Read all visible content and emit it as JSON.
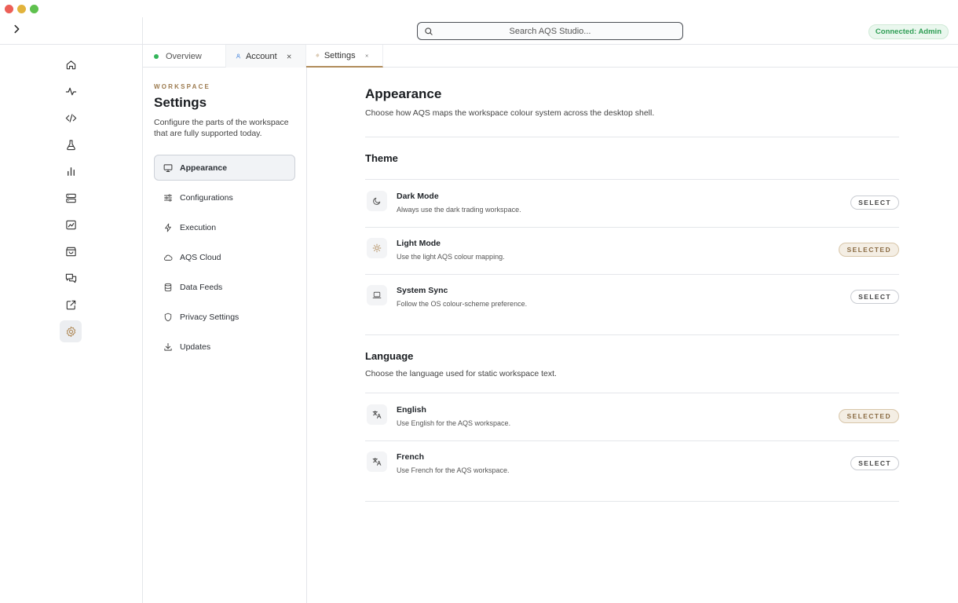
{
  "app": {
    "search_placeholder": "Search AQS Studio...",
    "connection_badge": "Connected: Admin"
  },
  "rail": {
    "icons": [
      "home-icon",
      "activity-icon",
      "code-icon",
      "flask-icon",
      "bar-chart-icon",
      "server-icon",
      "line-chart-icon",
      "shopping-bag-icon",
      "chat-icon",
      "external-link-icon",
      "gear-icon"
    ],
    "active": "gear-icon"
  },
  "tabs": [
    {
      "label": "Overview",
      "status_color": "#33b55a"
    },
    {
      "label": "Account"
    },
    {
      "label": "Settings",
      "active": true
    }
  ],
  "subnav": {
    "kicker": "WORKSPACE",
    "title": "Settings",
    "description": "Configure the parts of the workspace that are fully supported today.",
    "items": [
      {
        "label": "Appearance",
        "icon": "monitor-icon",
        "active": true
      },
      {
        "label": "Configurations",
        "icon": "sliders-icon"
      },
      {
        "label": "Execution",
        "icon": "bolt-icon"
      },
      {
        "label": "AQS Cloud",
        "icon": "cloud-icon"
      },
      {
        "label": "Data Feeds",
        "icon": "database-icon"
      },
      {
        "label": "Privacy Settings",
        "icon": "shield-icon"
      },
      {
        "label": "Updates",
        "icon": "download-icon"
      }
    ]
  },
  "main": {
    "title": "Appearance",
    "description": "Choose how AQS maps the workspace colour system across the desktop shell.",
    "theme": {
      "heading": "Theme",
      "options": [
        {
          "title": "Dark Mode",
          "subtitle": "Always use the dark trading workspace.",
          "button": "SELECT",
          "icon": "moon-icon"
        },
        {
          "title": "Light Mode",
          "subtitle": "Use the light AQS colour mapping.",
          "button": "SELECTED",
          "icon": "sun-icon"
        },
        {
          "title": "System Sync",
          "subtitle": "Follow the OS colour-scheme preference.",
          "button": "SELECT",
          "icon": "laptop-icon"
        }
      ]
    },
    "language": {
      "heading": "Language",
      "description": "Choose the language used for static workspace text.",
      "options": [
        {
          "title": "English",
          "subtitle": "Use English for the AQS workspace.",
          "button": "SELECTED",
          "icon": "translate-icon"
        },
        {
          "title": "French",
          "subtitle": "Use French for the AQS workspace.",
          "button": "SELECT",
          "icon": "translate-icon"
        }
      ]
    }
  },
  "colors": {
    "accent": "#b08b5a",
    "connected_green": "#2f9e55",
    "selected_bg": "#f4eee4"
  }
}
